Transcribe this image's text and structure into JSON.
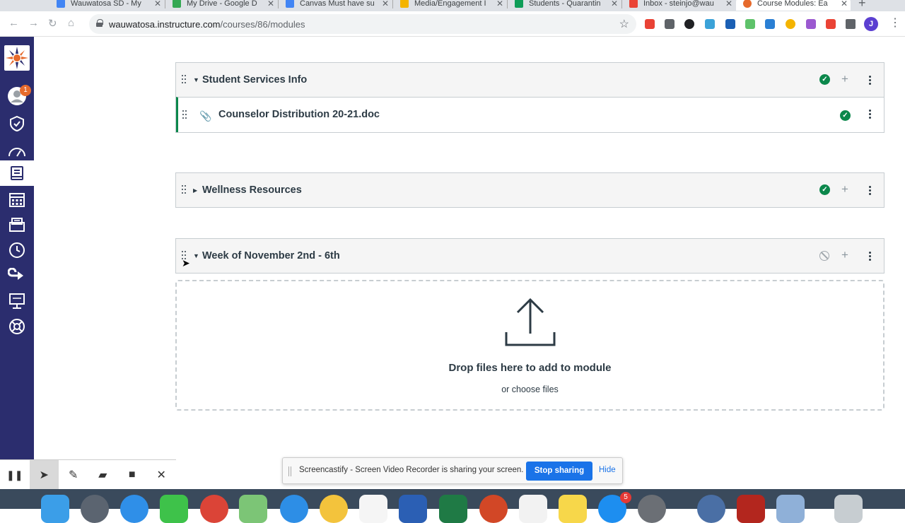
{
  "browser": {
    "tabs": [
      {
        "title": "Wauwatosa SD - My",
        "color": "#4285f4",
        "active": false
      },
      {
        "title": "My Drive - Google D",
        "color": "#34a853",
        "active": false
      },
      {
        "title": "Canvas Must have su",
        "color": "#4285f4",
        "active": false
      },
      {
        "title": "Media/Engagement I",
        "color": "#f4b400",
        "active": false
      },
      {
        "title": "Students - Quarantin",
        "color": "#0f9d58",
        "active": false
      },
      {
        "title": "Inbox - steinjo@wau",
        "color": "#ea4335",
        "active": false
      },
      {
        "title": "Course Modules: Ea",
        "color": "#e66a2c",
        "active": true
      }
    ],
    "url_domain": "wauwatosa.instructure.com",
    "url_path": "/courses/86/modules",
    "profile_initial": "J"
  },
  "global_nav": {
    "items": [
      {
        "name": "account",
        "icon": "user-avatar-icon",
        "badge": "1"
      },
      {
        "name": "admin",
        "icon": "shield-icon"
      },
      {
        "name": "dashboard",
        "icon": "speedometer-icon"
      },
      {
        "name": "courses",
        "icon": "book-icon",
        "active": true
      },
      {
        "name": "calendar",
        "icon": "calendar-icon"
      },
      {
        "name": "inbox",
        "icon": "inbox-icon"
      },
      {
        "name": "history",
        "icon": "clock-icon"
      },
      {
        "name": "commons",
        "icon": "arrow-loop-icon"
      },
      {
        "name": "studio",
        "icon": "presentation-icon"
      },
      {
        "name": "help",
        "icon": "lifebuoy-icon"
      }
    ]
  },
  "modules": [
    {
      "title": "Student Services Info",
      "expanded": true,
      "published": true,
      "items": [
        {
          "title": "Counselor Distribution 20-21.doc",
          "icon": "paperclip-icon",
          "published": true
        }
      ]
    },
    {
      "title": "Wellness Resources",
      "expanded": false,
      "published": true,
      "items": []
    },
    {
      "title": "Week of November 2nd - 6th",
      "expanded": true,
      "published": false,
      "items": []
    }
  ],
  "dropzone": {
    "main_text": "Drop files here to add to module",
    "link_text": "or choose files"
  },
  "screencastify": {
    "message": "Screencastify - Screen Video Recorder is sharing your screen.",
    "stop_label": "Stop sharing",
    "hide_label": "Hide"
  },
  "dock": {
    "badges": [
      "5"
    ]
  },
  "colors": {
    "nav_bg": "#2b2d6e",
    "published_green": "#0b874b",
    "accent_blue": "#1a73e8"
  }
}
